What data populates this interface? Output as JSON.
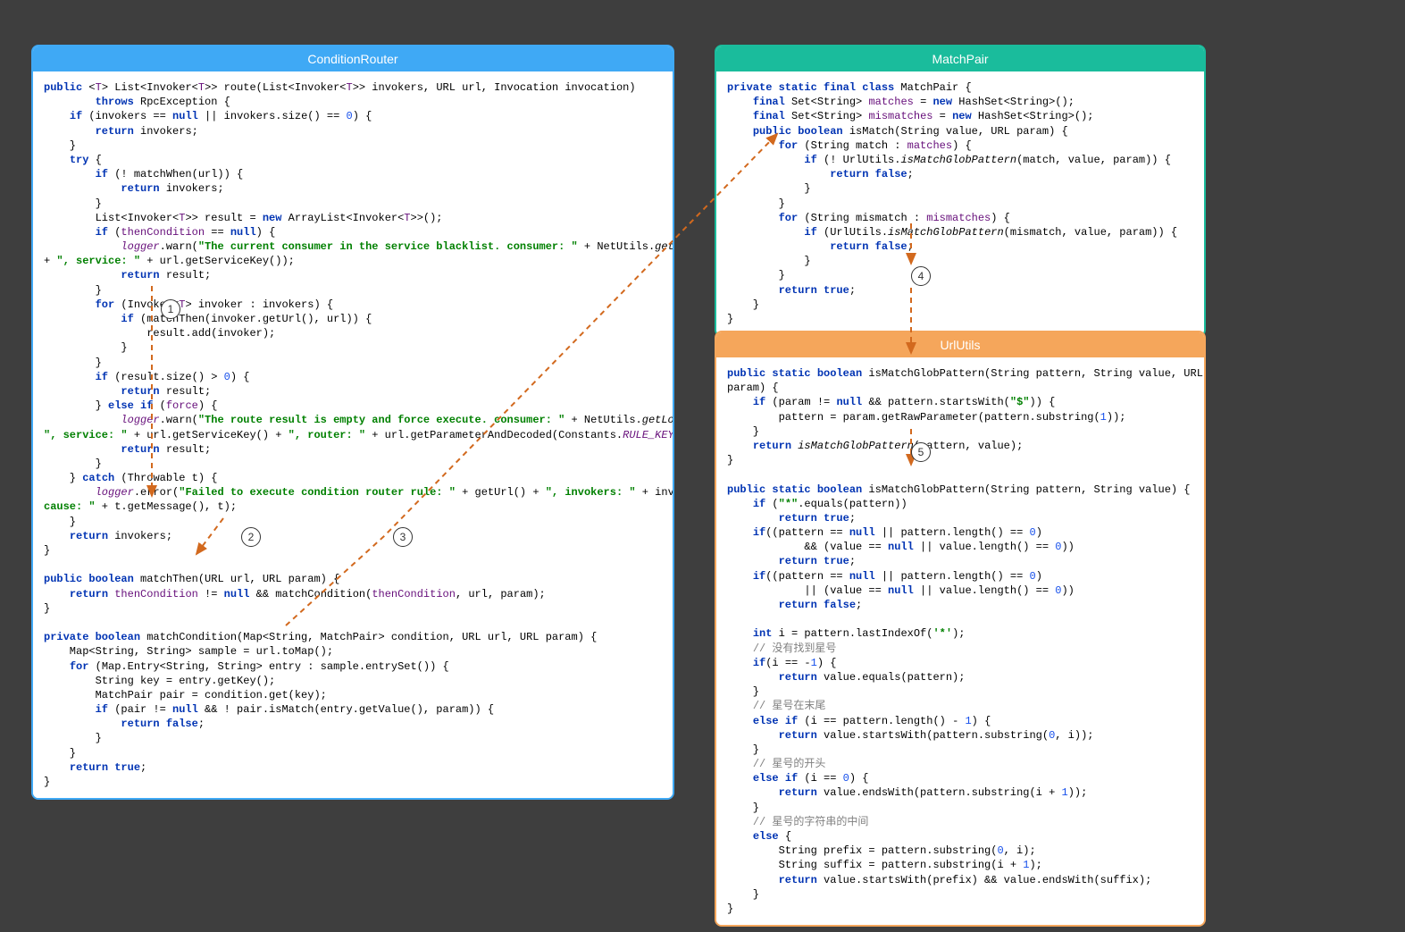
{
  "panels": {
    "conditionRouter": {
      "title": "ConditionRouter",
      "code_html": "<span class='kw'>public</span> &lt;<span class='fld'>T</span>&gt; List&lt;Invoker&lt;<span class='fld'>T</span>&gt;&gt; route(List&lt;Invoker&lt;<span class='fld'>T</span>&gt;&gt; invokers, URL url, Invocation invocation)\n        <span class='kw'>throws</span> RpcException {\n    <span class='kw'>if</span> (invokers == <span class='kw'>null</span> || invokers.size() == <span class='num'>0</span>) {\n        <span class='kw'>return</span> invokers;\n    }\n    <span class='kw'>try</span> {\n        <span class='kw'>if</span> (! matchWhen(url)) {\n            <span class='kw'>return</span> invokers;\n        }\n        List&lt;Invoker&lt;<span class='fld'>T</span>&gt;&gt; result = <span class='kw'>new</span> ArrayList&lt;Invoker&lt;<span class='fld'>T</span>&gt;&gt;();\n        <span class='kw'>if</span> (<span class='fld'>thenCondition</span> == <span class='kw'>null</span>) {\n            <span class='fldi'>logger</span>.warn(<span class='str'>\"The current consumer in the service blacklist. consumer: \"</span> + NetUtils.<span class='em'>getLocalHost</span>()\n+ <span class='str'>\", service: \"</span> + url.getServiceKey());\n            <span class='kw'>return</span> result;\n        }\n        <span class='kw'>for</span> (Invoker&lt;<span class='fld'>T</span>&gt; invoker : invokers) {\n            <span class='kw'>if</span> (matchThen(invoker.getUrl(), url)) {\n                result.add(invoker);\n            }\n        }\n        <span class='kw'>if</span> (result.size() &gt; <span class='num'>0</span>) {\n            <span class='kw'>return</span> result;\n        } <span class='kw'>else if</span> (<span class='fld'>force</span>) {\n            <span class='fldi'>logger</span>.warn(<span class='str'>\"The route result is empty and force execute. consumer: \"</span> + NetUtils.<span class='em'>getLocalHost</span>() +\n<span class='str'>\", service: \"</span> + url.getServiceKey() + <span class='str'>\", router: \"</span> + url.getParameterAndDecoded(Constants.<span class='fldi'>RULE_KEY</span>));\n            <span class='kw'>return</span> result;\n        }\n    } <span class='kw'>catch</span> (Throwable t) {\n        <span class='fldi'>logger</span>.error(<span class='str'>\"Failed to execute condition router rule: \"</span> + getUrl() + <span class='str'>\", invokers: \"</span> + invokers + <span class='str'>\",\ncause: \"</span> + t.getMessage(), t);\n    }\n    <span class='kw'>return</span> invokers;\n}\n\n<span class='kw'>public boolean</span> matchThen(URL url, URL param) {\n    <span class='kw'>return</span> <span class='fld'>thenCondition</span> != <span class='kw'>null</span> &amp;&amp; matchCondition(<span class='fld'>thenCondition</span>, url, param);\n}\n\n<span class='kw'>private boolean</span> matchCondition(Map&lt;String, MatchPair&gt; condition, URL url, URL param) {\n    Map&lt;String, String&gt; sample = url.toMap();\n    <span class='kw'>for</span> (Map.Entry&lt;String, String&gt; entry : sample.entrySet()) {\n        String key = entry.getKey();\n        MatchPair pair = condition.get(key);\n        <span class='kw'>if</span> (pair != <span class='kw'>null</span> &amp;&amp; ! pair.isMatch(entry.getValue(), param)) {\n            <span class='kw'>return false</span>;\n        }\n    }\n    <span class='kw'>return true</span>;\n}"
    },
    "matchPair": {
      "title": "MatchPair",
      "code_html": "<span class='kw'>private static final class</span> MatchPair {\n    <span class='kw'>final</span> Set&lt;String&gt; <span class='fld'>matches</span> = <span class='kw'>new</span> HashSet&lt;String&gt;();\n    <span class='kw'>final</span> Set&lt;String&gt; <span class='fld'>mismatches</span> = <span class='kw'>new</span> HashSet&lt;String&gt;();\n    <span class='kw'>public boolean</span> isMatch(String value, URL param) {\n        <span class='kw'>for</span> (String match : <span class='fld'>matches</span>) {\n            <span class='kw'>if</span> (! UrlUtils.<span class='em'>isMatchGlobPattern</span>(match, value, param)) {\n                <span class='kw'>return false</span>;\n            }\n        }\n        <span class='kw'>for</span> (String mismatch : <span class='fld'>mismatches</span>) {\n            <span class='kw'>if</span> (UrlUtils.<span class='em'>isMatchGlobPattern</span>(mismatch, value, param)) {\n                <span class='kw'>return false</span>;\n            }\n        }\n        <span class='kw'>return true</span>;\n    }\n}"
    },
    "urlUtils": {
      "title": "UrlUtils",
      "code_html": "<span class='kw'>public static boolean</span> isMatchGlobPattern(String pattern, String value, URL\nparam) {\n    <span class='kw'>if</span> (param != <span class='kw'>null</span> &amp;&amp; pattern.startsWith(<span class='str'>\"$\"</span>)) {\n        pattern = param.getRawParameter(pattern.substring(<span class='num'>1</span>));\n    }\n    <span class='kw'>return</span> <span class='em'>isMatchGlobPattern</span>(pattern, value);\n}\n\n<span class='kw'>public static boolean</span> isMatchGlobPattern(String pattern, String value) {\n    <span class='kw'>if</span> (<span class='str'>\"*\"</span>.equals(pattern))\n        <span class='kw'>return true</span>;\n    <span class='kw'>if</span>((pattern == <span class='kw'>null</span> || pattern.length() == <span class='num'>0</span>)\n            &amp;&amp; (value == <span class='kw'>null</span> || value.length() == <span class='num'>0</span>))\n        <span class='kw'>return true</span>;\n    <span class='kw'>if</span>((pattern == <span class='kw'>null</span> || pattern.length() == <span class='num'>0</span>)\n            || (value == <span class='kw'>null</span> || value.length() == <span class='num'>0</span>))\n        <span class='kw'>return false</span>;\n\n    <span class='kw'>int</span> i = pattern.lastIndexOf(<span class='str'>'*'</span>);\n    <span class='cmt'>// 没有找到星号</span>\n    <span class='kw'>if</span>(i == -<span class='num'>1</span>) {\n        <span class='kw'>return</span> value.equals(pattern);\n    }\n    <span class='cmt'>// 星号在末尾</span>\n    <span class='kw'>else if</span> (i == pattern.length() - <span class='num'>1</span>) {\n        <span class='kw'>return</span> value.startsWith(pattern.substring(<span class='num'>0</span>, i));\n    }\n    <span class='cmt'>// 星号的开头</span>\n    <span class='kw'>else if</span> (i == <span class='num'>0</span>) {\n        <span class='kw'>return</span> value.endsWith(pattern.substring(i + <span class='num'>1</span>));\n    }\n    <span class='cmt'>// 星号的字符串的中间</span>\n    <span class='kw'>else</span> {\n        String prefix = pattern.substring(<span class='num'>0</span>, i);\n        String suffix = pattern.substring(i + <span class='num'>1</span>);\n        <span class='kw'>return</span> value.startsWith(prefix) &amp;&amp; value.endsWith(suffix);\n    }\n}"
    }
  },
  "annotations": {
    "badges": [
      {
        "id": "1",
        "label": "1"
      },
      {
        "id": "2",
        "label": "2"
      },
      {
        "id": "3",
        "label": "3"
      },
      {
        "id": "4",
        "label": "4"
      },
      {
        "id": "5",
        "label": "5"
      }
    ],
    "arrows_description": "Dashed orange arrows: (1) from matchThen() call in route() down to matchThen() definition; (2) from matchCondition() call in matchThen() down to matchCondition() definition; (3) from pair.isMatch() call in matchCondition() over to MatchPair.isMatch() body; (4) from UrlUtils.isMatchGlobPattern() call inside MatchPair down to UrlUtils panel; (5) from first isMatchGlobPattern overload to second overload inside UrlUtils."
  },
  "colors": {
    "arrow": "#d2691e",
    "blue": "#3fa9f5",
    "teal": "#1abc9c",
    "orange": "#f5a65b",
    "bg": "#3e3e3e"
  }
}
